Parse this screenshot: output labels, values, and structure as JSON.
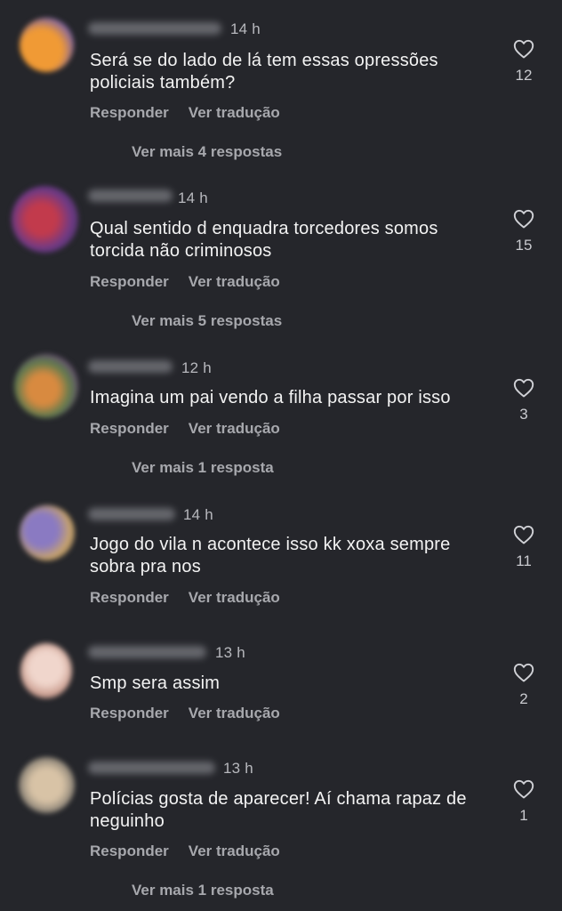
{
  "comments": [
    {
      "time": "14 h",
      "text": "Será se do lado de lá tem essas opressões policiais também?",
      "likes": "12",
      "reply_label": "Responder",
      "translate_label": "Ver tradução",
      "more_replies": "Ver mais 4 respostas",
      "avatar_colors": [
        "#e8922f",
        "#8a6fb0"
      ]
    },
    {
      "time": "14 h",
      "text": "Qual sentido d enquadra torcedores somos torcida não  criminosos",
      "likes": "15",
      "reply_label": "Responder",
      "translate_label": "Ver tradução",
      "more_replies": "Ver mais 5 respostas",
      "avatar_colors": [
        "#b5364a",
        "#5b3a7a"
      ]
    },
    {
      "time": "12 h",
      "text": "Imagina um pai vendo a filha passar por isso",
      "likes": "3",
      "reply_label": "Responder",
      "translate_label": "Ver tradução",
      "more_replies": "Ver mais 1 resposta",
      "avatar_colors": [
        "#d27a3c",
        "#4a6b4a"
      ]
    },
    {
      "time": "14 h",
      "text": "Jogo do vila n acontece isso kk xoxa sempre sobra pra nos",
      "likes": "11",
      "reply_label": "Responder",
      "translate_label": "Ver tradução",
      "more_replies": "",
      "avatar_colors": [
        "#7b6fb8",
        "#c9a46a"
      ]
    },
    {
      "time": "13 h",
      "text": "Smp sera assim",
      "likes": "2",
      "reply_label": "Responder",
      "translate_label": "Ver tradução",
      "more_replies": "",
      "avatar_colors": [
        "#e8c9bd",
        "#c79a8c"
      ]
    },
    {
      "time": "13 h",
      "text": "Polícias gosta de aparecer! Aí chama rapaz de neguinho",
      "likes": "1",
      "reply_label": "Responder",
      "translate_label": "Ver tradução",
      "more_replies": "Ver mais 1 resposta",
      "avatar_colors": [
        "#cbb59a",
        "#6e6a64"
      ]
    }
  ],
  "icons": {
    "like": "heart-outline-icon"
  },
  "colors": {
    "background": "#25262b",
    "text": "#f3f3f3",
    "muted": "#a7a8ad"
  }
}
